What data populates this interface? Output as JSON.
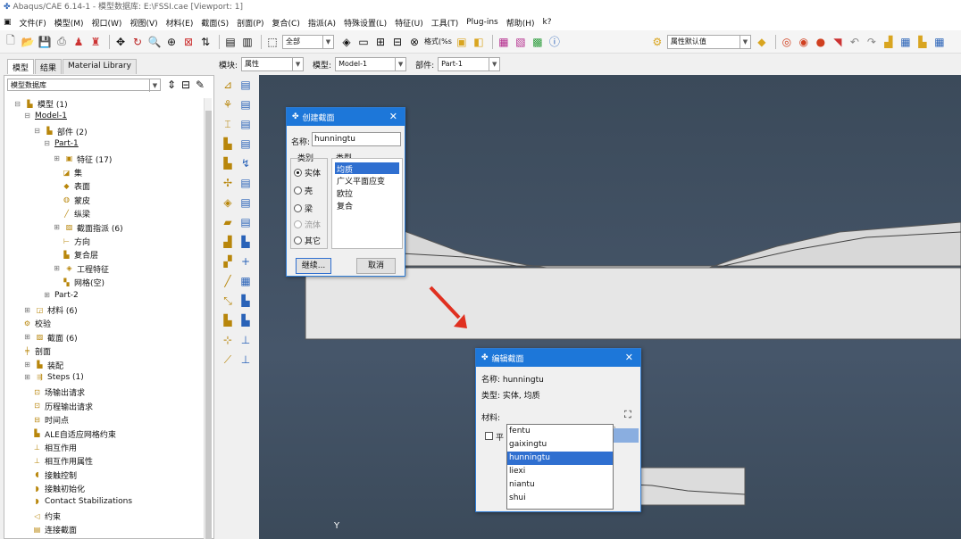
{
  "window_title": "Abaqus/CAE 6.14-1 - 模型数据库: E:\\FSSI.cae [Viewport: 1]",
  "menu": [
    "文件(F)",
    "模型(M)",
    "视口(W)",
    "视图(V)",
    "材料(E)",
    "截面(S)",
    "剖面(P)",
    "复合(C)",
    "指派(A)",
    "特殊设置(L)",
    "特征(U)",
    "工具(T)",
    "Plug-ins",
    "帮助(H)",
    "k?"
  ],
  "toolbar": {
    "render_combo": "全部",
    "display_label": "格式(%s",
    "attr_combo": "属性默认值"
  },
  "tabs": [
    "模型",
    "结果",
    "Material Library"
  ],
  "tree_combo": "模型数据库",
  "module_bar": {
    "module_label": "模块:",
    "module_value": "属性",
    "model_label": "模型:",
    "model_value": "Model-1",
    "part_label": "部件:",
    "part_value": "Part-1"
  },
  "tree": [
    {
      "label": "模型 (1)",
      "icon": "models-icon",
      "exp": "⊟"
    },
    {
      "label": "Model-1",
      "icon": "",
      "exp": "⊟"
    },
    {
      "label": "部件 (2)",
      "icon": "parts-icon",
      "exp": "⊟"
    },
    {
      "label": "Part-1",
      "icon": "",
      "exp": "⊟"
    },
    {
      "label": "特征 (17)",
      "icon": "features-icon",
      "exp": "⊞"
    },
    {
      "label": "集",
      "icon": "sets-icon",
      "exp": ""
    },
    {
      "label": "表面",
      "icon": "surfaces-icon",
      "exp": ""
    },
    {
      "label": "蒙皮",
      "icon": "skins-icon",
      "exp": ""
    },
    {
      "label": "纵梁",
      "icon": "stringers-icon",
      "exp": ""
    },
    {
      "label": "截面指派 (6)",
      "icon": "section-assign-icon",
      "exp": "⊞"
    },
    {
      "label": "方向",
      "icon": "orientation-icon",
      "exp": ""
    },
    {
      "label": "复合层",
      "icon": "composite-icon",
      "exp": ""
    },
    {
      "label": "工程特征",
      "icon": "engineering-icon",
      "exp": "⊞"
    },
    {
      "label": "网格(空)",
      "icon": "mesh-icon",
      "exp": ""
    },
    {
      "label": "Part-2",
      "icon": "",
      "exp": "⊞"
    },
    {
      "label": "材料 (6)",
      "icon": "materials-icon",
      "exp": "⊞"
    },
    {
      "label": "校验",
      "icon": "calibration-icon",
      "exp": ""
    },
    {
      "label": "截面 (6)",
      "icon": "sections-icon",
      "exp": "⊞"
    },
    {
      "label": "剖面",
      "icon": "profiles-icon",
      "exp": ""
    },
    {
      "label": "装配",
      "icon": "assembly-icon",
      "exp": "⊞"
    },
    {
      "label": "Steps (1)",
      "icon": "steps-icon",
      "exp": "⊞"
    },
    {
      "label": "场输出请求",
      "icon": "field-output-icon",
      "exp": ""
    },
    {
      "label": "历程输出请求",
      "icon": "history-output-icon",
      "exp": ""
    },
    {
      "label": "时间点",
      "icon": "time-points-icon",
      "exp": ""
    },
    {
      "label": "ALE自适应网格约束",
      "icon": "ale-icon",
      "exp": ""
    },
    {
      "label": "相互作用",
      "icon": "interactions-icon",
      "exp": ""
    },
    {
      "label": "相互作用属性",
      "icon": "interaction-props-icon",
      "exp": ""
    },
    {
      "label": "接触控制",
      "icon": "contact-controls-icon",
      "exp": ""
    },
    {
      "label": "接触初始化",
      "icon": "contact-init-icon",
      "exp": ""
    },
    {
      "label": "Contact Stabilizations",
      "icon": "contact-stab-icon",
      "exp": ""
    },
    {
      "label": "约束",
      "icon": "constraints-icon",
      "exp": ""
    },
    {
      "label": "连接截面",
      "icon": "connector-sections-icon",
      "exp": ""
    }
  ],
  "create_section": {
    "title": "创建截面",
    "name_label": "名称:",
    "name_value": "hunningtu",
    "category_label": "类别",
    "type_label": "类型",
    "categories": [
      "实体",
      "壳",
      "梁",
      "流体",
      "其它"
    ],
    "types": [
      "均质",
      "广义平面应变",
      "欧拉",
      "复合"
    ],
    "continue_label": "继续...",
    "cancel_label": "取消"
  },
  "edit_section": {
    "title": "编辑截面",
    "name_text": "名称: hunningtu",
    "type_text": "类型: 实体, 均质",
    "material_label": "材料:",
    "material_value": "hunningtu",
    "check_label": "平",
    "options": [
      "fentu",
      "gaixingtu",
      "hunningtu",
      "liexi",
      "niantu",
      "shui"
    ],
    "selected": "hunningtu"
  },
  "axis_label": "Y",
  "colors": {
    "dialog_header": "#1d77d9",
    "selection": "#2f6fd0",
    "viewport_bg": "#3f4e60",
    "arrow": "#e03020"
  }
}
